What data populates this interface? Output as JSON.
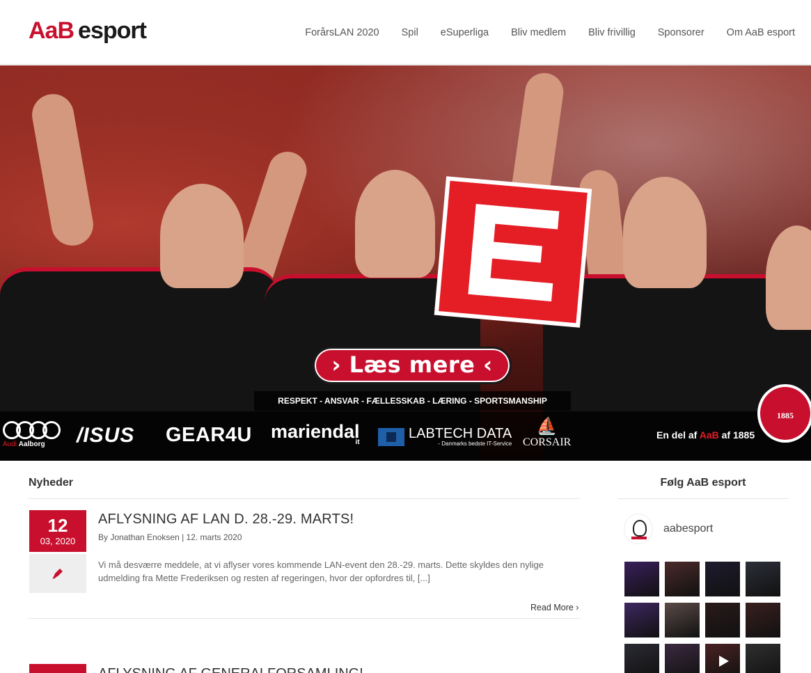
{
  "header": {
    "logo_aab": "AaB",
    "logo_esport": "esport",
    "nav": [
      "ForårsLAN 2020",
      "Spil",
      "eSuperliga",
      "Bliv medlem",
      "Bliv frivillig",
      "Sponsorer",
      "Om AaB esport"
    ]
  },
  "hero": {
    "button_label": "› Læs mere ‹",
    "values": "RESPEKT - ANSVAR - FÆLLESSKAB - LÆRING - SPORTSMANSHIP",
    "sponsors": {
      "audi_sub_a": "Audi",
      "audi_sub_b": "Aalborg",
      "asus": "/ISUS",
      "gear4u": "GEAR4U",
      "mariendal": "mariendal",
      "mariendal_it": "it",
      "labtech": "LABTECH DATA",
      "labtech_sub": "- Danmarks bedste IT-Service",
      "corsair": "CORSAIR"
    },
    "endel_prefix": "En del af",
    "endel_aab": "AaB",
    "endel_suffix": "af 1885",
    "badge_year": "1885"
  },
  "news": {
    "section_title": "Nyheder",
    "posts": [
      {
        "day": "12",
        "month_year": "03, 2020",
        "title": "AFLYSNING AF LAN D. 28.-29. MARTS!",
        "meta": "By Jonathan Enoksen  |  12. marts 2020",
        "excerpt": "Vi må desværre meddele, at vi aflyser vores kommende LAN-event den 28.-29. marts. Dette skyldes den nylige udmelding fra Mette Frederiksen og resten af regeringen, hvor der opfordres til, [...]",
        "read_more": "Read More ›"
      },
      {
        "title": "AFLYSNING AF GENERALFORSAMLING!"
      }
    ]
  },
  "sidebar": {
    "title": "Følg AaB esport",
    "instagram_handle": "aabesport",
    "tile_colors": [
      "#3a1f5c",
      "#4b2a2a",
      "#1e1b2e",
      "#2b2f38",
      "#3d2760",
      "#5a4b48",
      "#2a1a1a",
      "#3a1f1f",
      "#2a2a33",
      "#3b2a40",
      "#4a2222",
      "#2f2f2f"
    ]
  },
  "colors": {
    "brand_red": "#c8102e",
    "text_dark": "#333333"
  }
}
